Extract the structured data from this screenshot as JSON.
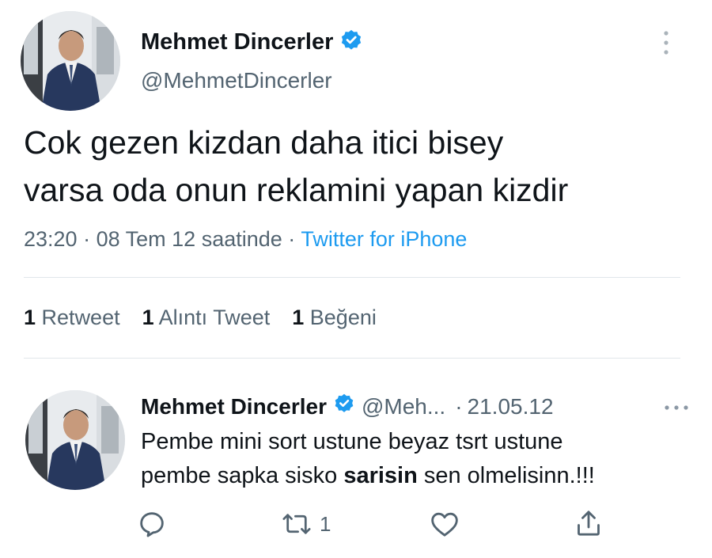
{
  "tweet": {
    "author_name": "Mehmet Dincerler",
    "handle": "@MehmetDincerler",
    "verified": true,
    "text_lines": [
      "Cok gezen kizdan daha itici bisey",
      "varsa oda onun reklamini yapan kizdir"
    ],
    "time": "23:20",
    "date": "08 Tem 12 saatinde",
    "separator": "·",
    "source": "Twitter for iPhone",
    "retweet_count": "1",
    "retweet_label": "Retweet",
    "quote_count": "1",
    "quote_label": "Alıntı Tweet",
    "like_count": "1",
    "like_label": "Beğeni"
  },
  "reply": {
    "author_name": "Mehmet Dincerler",
    "handle": "@Meh...",
    "separator": "·",
    "date": "21.05.12",
    "line1": "Pembe mini sort ustune beyaz tsrt ustune",
    "line2_before": "pembe sapka sisko ",
    "line2_bold": "sarisin",
    "line2_after": " sen olmelisinn.!!!",
    "retweet_count": "1"
  },
  "icons": {
    "verified": "verified-badge-icon",
    "more_vertical": "more-vertical-icon",
    "more_horizontal": "more-horizontal-icon",
    "reply": "reply-icon",
    "retweet": "retweet-icon",
    "like": "heart-icon",
    "share": "share-icon"
  },
  "colors": {
    "accent": "#1d9bf0",
    "text": "#0f1419",
    "secondary": "#536471",
    "divider": "#e1e6ea"
  }
}
